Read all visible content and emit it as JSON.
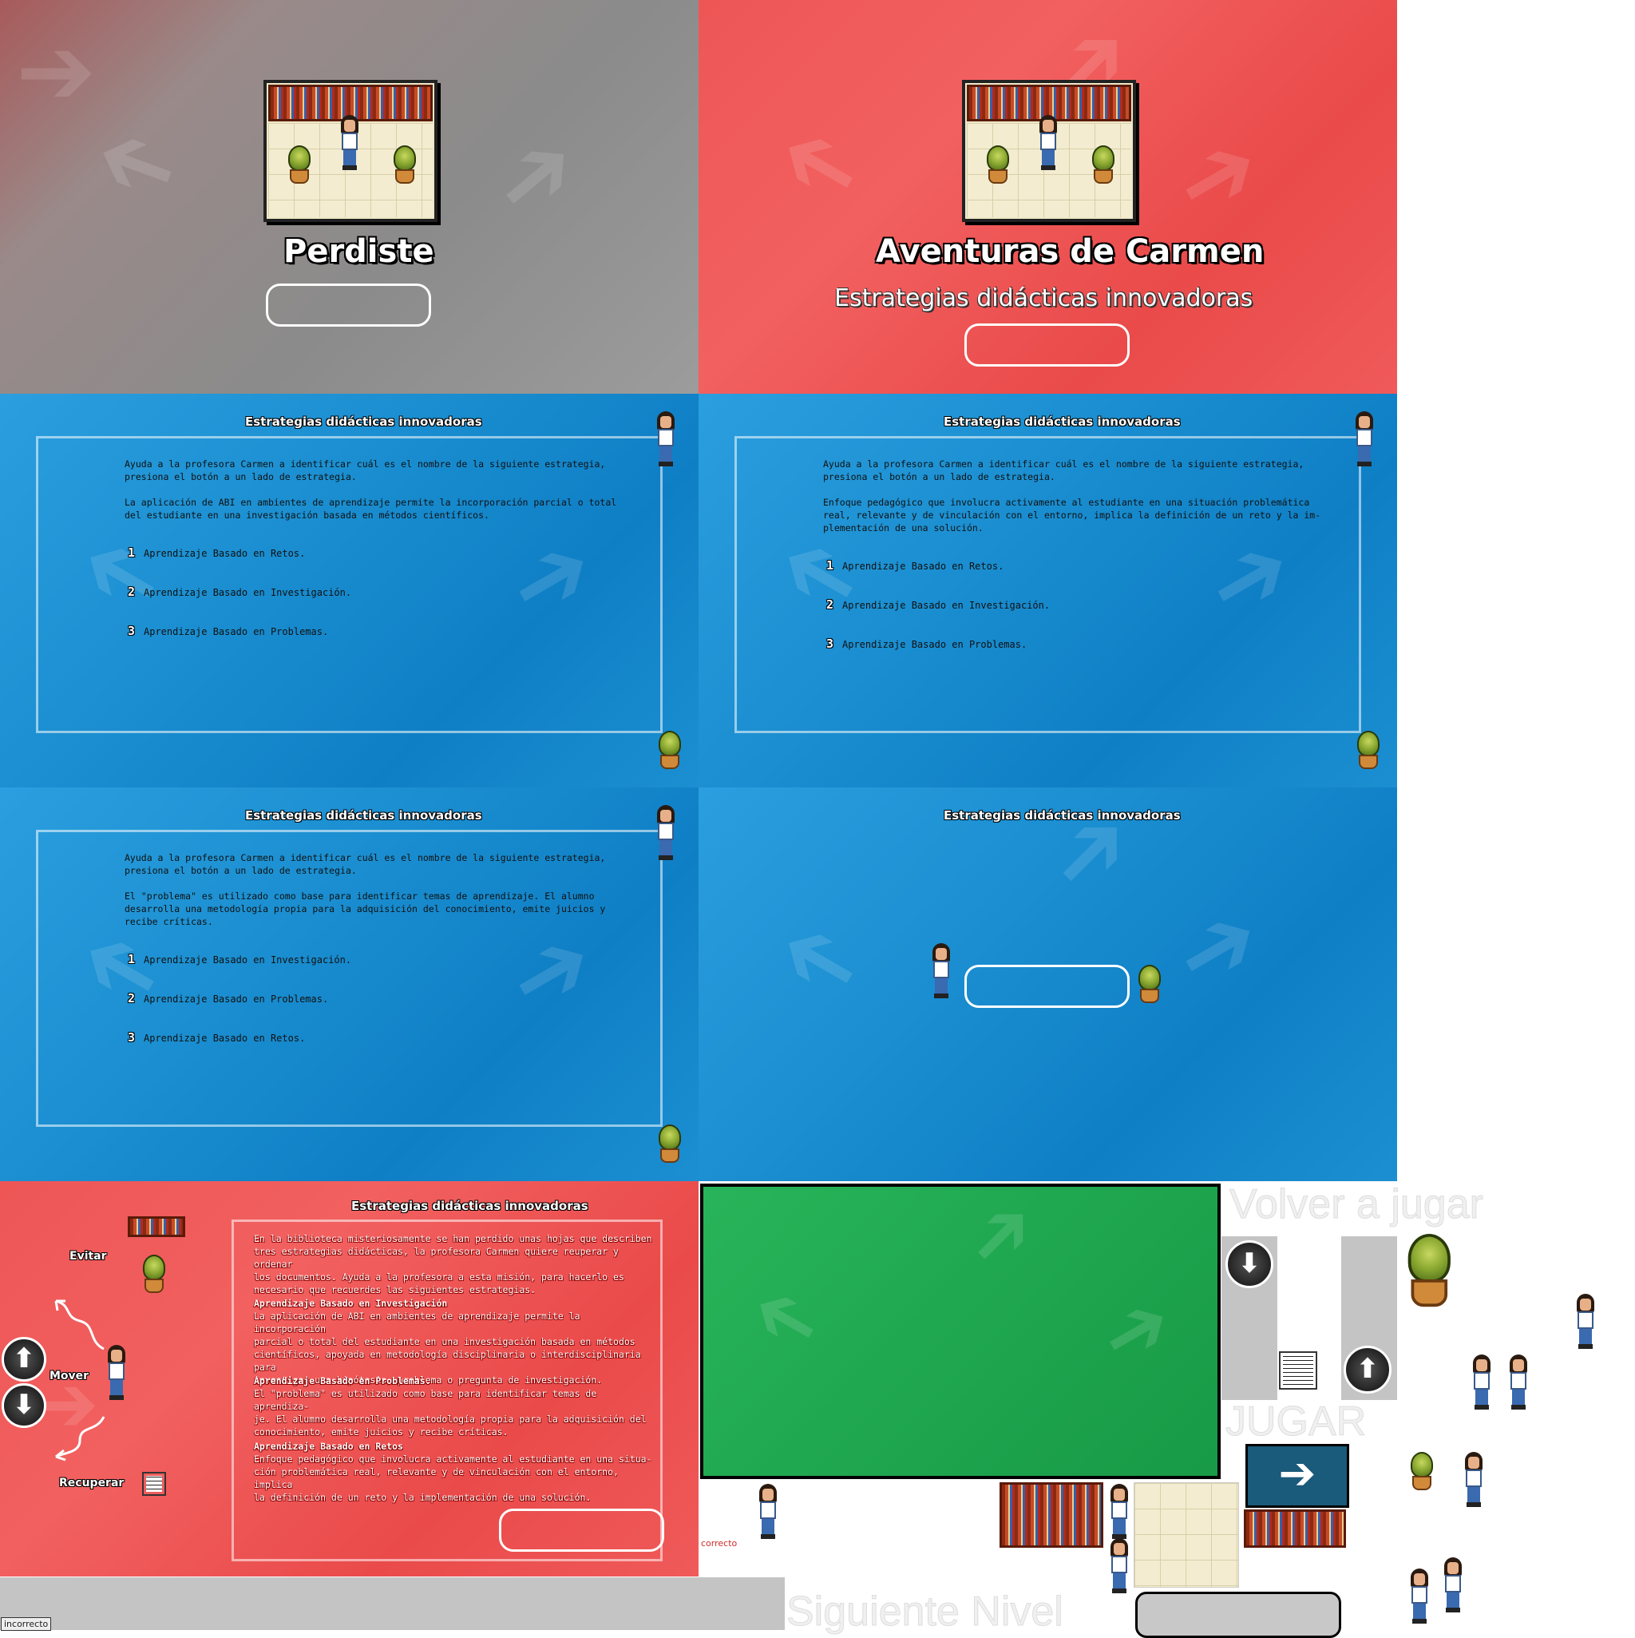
{
  "lose_screen": {
    "title": "Perdiste"
  },
  "intro_screen": {
    "title": "Aventuras de Carmen",
    "subtitle": "Estrategias didácticas innovadoras"
  },
  "question_1": {
    "header": "Estrategias didácticas innovadoras",
    "prompt": "Ayuda a la profesora Carmen a identificar  cuál es el nombre de la siguiente estrategia,\npresiona el botón a un lado de estrategia.",
    "description": "La aplicación de ABI en ambientes de aprendizaje permite la incorporación parcial o total\ndel estudiante en una investigación basada en métodos científicos.",
    "options": [
      {
        "num": "1",
        "label": "Aprendizaje Basado en Retos."
      },
      {
        "num": "2",
        "label": "Aprendizaje Basado en Investigación."
      },
      {
        "num": "3",
        "label": "Aprendizaje Basado en Problemas."
      }
    ]
  },
  "question_2": {
    "header": "Estrategias didácticas innovadoras",
    "prompt": "Ayuda a la profesora Carmen a identificar  cuál es el nombre de la siguiente estrategia,\npresiona el botón a un lado de estrategia.",
    "description": "Enfoque pedagógico que involucra activamente al estudiante en una situación problemática\nreal, relevante y de vinculación con el entorno, implica la definición de un reto y la im-\nplementación de una solución.",
    "options": [
      {
        "num": "1",
        "label": "Aprendizaje Basado en Retos."
      },
      {
        "num": "2",
        "label": "Aprendizaje Basado en Investigación."
      },
      {
        "num": "3",
        "label": "Aprendizaje Basado en Problemas."
      }
    ]
  },
  "question_3": {
    "header": "Estrategias didácticas innovadoras",
    "prompt": "Ayuda a la profesora Carmen a identificar  cuál es el nombre de la siguiente estrategia,\npresiona el botón a un lado de estrategia.",
    "description": "El \"problema\" es utilizado como base para identificar temas de aprendizaje. El alumno\ndesarrolla una metodología propia para la adquisición del conocimiento, emite juicios y\nrecibe críticas.",
    "options": [
      {
        "num": "1",
        "label": "Aprendizaje Basado en Investigación."
      },
      {
        "num": "2",
        "label": "Aprendizaje Basado en Problemas."
      },
      {
        "num": "3",
        "label": "Aprendizaje Basado en Retos."
      }
    ]
  },
  "result_screen": {
    "header": "Estrategias didácticas innovadoras"
  },
  "instructions_screen": {
    "header": "Estrategias didácticas innovadoras",
    "intro": "En la biblioteca misteriosamente se han perdido unas hojas que describen\ntres estrategias didácticas, la profesora Carmen quiere reuperar y ordenar\nlos documentos. Ayuda a la profesora a esta misión, para hacerlo es\nnecesario que recuerdes las siguientes estrategias.",
    "items": [
      {
        "title": "Aprendizaje Basado en Investigación",
        "text": "La aplicación de ABI en ambientes de aprendizaje permite la incorporación\nparcial o total del estudiante en una investigación basada en métodos\ncientíficos, apoyada en metodología disciplinaria o interdisciplinaria para\ninvestigar una hipótesis, problema o pregunta de investigación."
      },
      {
        "title": "Aprendizaje Basado en Problemas.",
        "text": "El \"problema\" es utilizado como base para identificar temas de aprendiza-\nje. El alumno desarrolla una metodología propia para la adquisición del\nconocimiento, emite juicios y recibe críticas."
      },
      {
        "title": "Aprendizaje Basado en Retos",
        "text": "Enfoque pedagógico que involucra activamente al estudiante en una situa-\nción problemática real, relevante y de vinculación con el entorno, implica\nla definición de un reto y la implementación de una solución."
      }
    ],
    "labels": {
      "evitar": "Evitar",
      "mover": "Mover",
      "recuperar": "Recuperar"
    }
  },
  "assets": {
    "volver_a_jugar": "Volver a jugar",
    "jugar": "JUGAR",
    "siguiente_nivel": "Siguiente Nivel",
    "correcto": "correcto",
    "incorrecto": "incorrecto"
  },
  "colors": {
    "red_panel": "#f05656",
    "blue_panel": "#1a8ed0",
    "gray_panel": "#8b8b8b",
    "green_panel": "#20a850"
  }
}
